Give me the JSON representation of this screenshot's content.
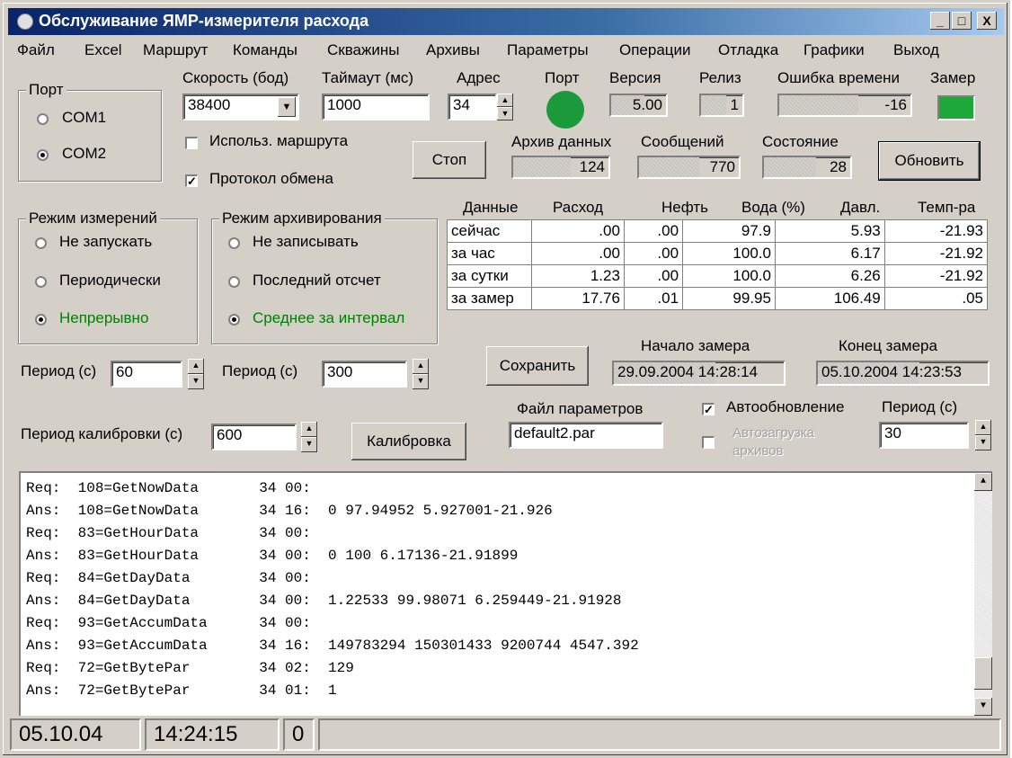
{
  "title": "Обслуживание ЯМР-измерителя расхода",
  "window_buttons": {
    "minimize": "_",
    "maximize": "□",
    "close": "X"
  },
  "menu": [
    "Файл",
    "Excel",
    "Маршрут",
    "Команды",
    "Скважины",
    "Архивы",
    "Параметры",
    "Операции",
    "Отладка",
    "Графики",
    "Выход"
  ],
  "port_group": {
    "title": "Порт",
    "options": [
      "COM1",
      "COM2"
    ],
    "selected": "COM2"
  },
  "speed": {
    "label": "Скорость (бод)",
    "value": "38400"
  },
  "timeout": {
    "label": "Таймаут (мс)",
    "value": "1000"
  },
  "address": {
    "label": "Адрес",
    "value": "34"
  },
  "port_status": {
    "label": "Порт",
    "color": "#1a9a3a"
  },
  "version": {
    "label": "Версия",
    "value": "5.00"
  },
  "release": {
    "label": "Релиз",
    "value": "1"
  },
  "time_error": {
    "label": "Ошибка времени",
    "value": "-16"
  },
  "measure": {
    "label": "Замер",
    "color": "#1fa83a"
  },
  "use_route": {
    "label": "Использ. маршрута",
    "checked": false
  },
  "protocol": {
    "label": "Протокол обмена",
    "checked": true
  },
  "stop_button": "Стоп",
  "archive_data": {
    "label": "Архив данных",
    "value": "124"
  },
  "messages": {
    "label": "Сообщений",
    "value": "770"
  },
  "state": {
    "label": "Состояние",
    "value": "28"
  },
  "refresh_button": "Обновить",
  "measure_mode": {
    "title": "Режим измерений",
    "options": [
      "Не запускать",
      "Периодически",
      "Непрерывно"
    ],
    "selected": "Непрерывно"
  },
  "archive_mode": {
    "title": "Режим архивирования",
    "options": [
      "Не записывать",
      "Последний отсчет",
      "Среднее за интервал"
    ],
    "selected": "Среднее за интервал"
  },
  "data_table": {
    "headers": [
      "Данные",
      "Расход",
      "Нефть",
      "Вода (%)",
      "Давл.",
      "Темп-ра"
    ],
    "rows": [
      [
        "сейчас",
        ".00",
        ".00",
        "97.9",
        "5.93",
        "-21.93"
      ],
      [
        "за час",
        ".00",
        ".00",
        "100.0",
        "6.17",
        "-21.92"
      ],
      [
        "за сутки",
        "1.23",
        ".00",
        "100.0",
        "6.26",
        "-21.92"
      ],
      [
        "за замер",
        "17.76",
        ".01",
        "99.95",
        "106.49",
        ".05"
      ]
    ]
  },
  "period1": {
    "label": "Период (с)",
    "value": "60"
  },
  "period2": {
    "label": "Период (с)",
    "value": "300"
  },
  "save_button": "Сохранить",
  "start_measure": {
    "label": "Начало замера",
    "value": "29.09.2004 14:28:14"
  },
  "end_measure": {
    "label": "Конец замера",
    "value": "05.10.2004 14:23:53"
  },
  "param_file": {
    "label": "Файл параметров",
    "value": "default2.par"
  },
  "auto_update": {
    "label": "Автообновление",
    "checked": true
  },
  "auto_load": {
    "label1": "Автозагрузка",
    "label2": "архивов",
    "checked": false
  },
  "period3": {
    "label": "Период (с)",
    "value": "30"
  },
  "calib_period": {
    "label": "Период калибровки (с)",
    "value": "600"
  },
  "calib_button": "Калибровка",
  "log": [
    "Req:  108=GetNowData       34 00:",
    "Ans:  108=GetNowData       34 16:  0 97.94952 5.927001-21.926",
    "Req:  83=GetHourData       34 00:",
    "Ans:  83=GetHourData       34 00:  0 100 6.17136-21.91899",
    "Req:  84=GetDayData        34 00:",
    "Ans:  84=GetDayData        34 00:  1.22533 99.98071 6.259449-21.91928",
    "Req:  93=GetAccumData      34 00:",
    "Ans:  93=GetAccumData      34 16:  149783294 150301433 9200744 4547.392",
    "Req:  72=GetBytePar        34 02:  129",
    "Ans:  72=GetBytePar        34 01:  1"
  ],
  "status": {
    "date": "05.10.04",
    "time": "14:24:15",
    "count": "0"
  }
}
